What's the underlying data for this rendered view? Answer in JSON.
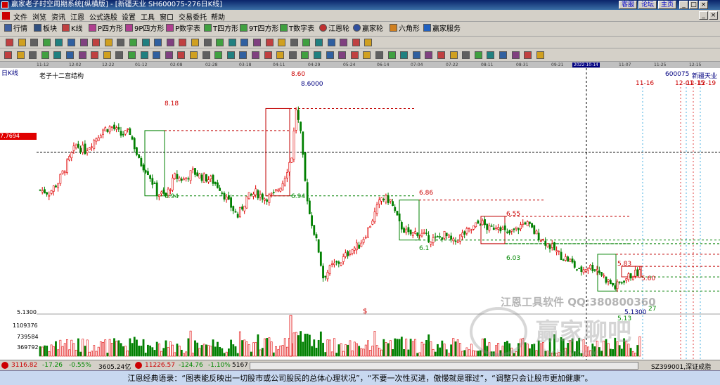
{
  "window": {
    "title": "赢家老子时空周期系统[纵横版] - [新疆天业  SH600075-276日K线]",
    "title_buttons": [
      "客服",
      "论坛",
      "主页"
    ],
    "controls": [
      "_",
      "□",
      "×",
      "_",
      "×"
    ]
  },
  "menu": [
    "文件",
    "浏览",
    "资讯",
    "江恩",
    "公式选股",
    "设置",
    "工具",
    "窗口",
    "交易委托",
    "帮助"
  ],
  "toolbar1": [
    "行情",
    "板块",
    "K线",
    "P四方形",
    "9P四方形",
    "P数字表",
    "T四方形",
    "9T四方形",
    "T数字表",
    "江恩轮",
    "赢家轮",
    "六角形",
    "赢家服务"
  ],
  "time_axis": {
    "labels": [
      "11-12",
      "12-02",
      "12-22",
      "01-12",
      "02-08",
      "02-28",
      "03-18",
      "04-11",
      "04-29",
      "05-24",
      "06-14",
      "07-04",
      "07-22",
      "08-11",
      "08-31",
      "09-21",
      "2022-10-14",
      "11-07",
      "11-25",
      "12-15"
    ],
    "current": "2022-10-14"
  },
  "chart": {
    "period_label": "日K线",
    "title": "老子十二宫结构",
    "stock_code": "600075",
    "stock_name": "新疆天业",
    "price_tag": "7.7694",
    "min_price_tag": "5.1300",
    "date_marks": [
      "11-16",
      "12-01",
      "12-15",
      "12-19"
    ],
    "box_labels": [
      "8.18",
      "6.94",
      "8.60",
      "6.94",
      "6.86",
      "6.1",
      "6.55",
      "6.03",
      "5.83",
      "5.60",
      "5.13",
      "27"
    ],
    "peak_label": "8.6000",
    "low_label": "5.1300",
    "dollar_mark": "$",
    "volume_ticks": [
      "1109376",
      "739584",
      "369792"
    ],
    "watermark_text": "江恩工具软件  QQ:380800360",
    "watermark_logo": "赢家聊吧",
    "watermark_url": "liaoba.yjcycle"
  },
  "chart_data": {
    "type": "candlestick",
    "ylim": [
      4.8,
      9.1
    ],
    "price_levels": {
      "current_line": 7.7694,
      "low": 5.13,
      "high": 8.6
    },
    "close_path": [
      [
        0,
        7.05
      ],
      [
        4,
        7.0
      ],
      [
        8,
        7.2
      ],
      [
        12,
        7.55
      ],
      [
        16,
        7.9
      ],
      [
        20,
        7.8
      ],
      [
        24,
        8.0
      ],
      [
        28,
        8.2
      ],
      [
        32,
        8.25
      ],
      [
        36,
        8.1
      ],
      [
        40,
        8.15
      ],
      [
        44,
        7.6
      ],
      [
        48,
        7.4
      ],
      [
        52,
        7.0
      ],
      [
        56,
        6.94
      ],
      [
        60,
        7.3
      ],
      [
        64,
        7.25
      ],
      [
        68,
        7.4
      ],
      [
        72,
        7.3
      ],
      [
        76,
        7.25
      ],
      [
        80,
        7.1
      ],
      [
        84,
        6.8
      ],
      [
        88,
        6.55
      ],
      [
        92,
        6.9
      ],
      [
        96,
        7.0
      ],
      [
        100,
        6.9
      ],
      [
        104,
        6.95
      ],
      [
        108,
        7.2
      ],
      [
        112,
        7.7
      ],
      [
        114,
        8.6
      ],
      [
        116,
        8.1
      ],
      [
        118,
        7.2
      ],
      [
        120,
        6.6
      ],
      [
        124,
        5.9
      ],
      [
        126,
        5.4
      ],
      [
        130,
        5.6
      ],
      [
        134,
        5.7
      ],
      [
        138,
        5.9
      ],
      [
        142,
        6.0
      ],
      [
        146,
        6.3
      ],
      [
        150,
        6.7
      ],
      [
        152,
        6.9
      ],
      [
        156,
        6.85
      ],
      [
        160,
        6.4
      ],
      [
        164,
        6.2
      ],
      [
        168,
        6.25
      ],
      [
        172,
        6.15
      ],
      [
        176,
        6.1
      ],
      [
        180,
        6.2
      ],
      [
        184,
        6.05
      ],
      [
        188,
        6.2
      ],
      [
        192,
        6.3
      ],
      [
        196,
        6.45
      ],
      [
        200,
        6.3
      ],
      [
        204,
        6.4
      ],
      [
        208,
        6.2
      ],
      [
        212,
        6.3
      ],
      [
        216,
        6.45
      ],
      [
        220,
        6.25
      ],
      [
        224,
        6.1
      ],
      [
        228,
        5.95
      ],
      [
        232,
        5.8
      ],
      [
        236,
        5.7
      ],
      [
        240,
        5.5
      ],
      [
        244,
        5.6
      ],
      [
        248,
        5.55
      ],
      [
        252,
        5.35
      ],
      [
        256,
        5.2
      ],
      [
        260,
        5.35
      ],
      [
        264,
        5.45
      ],
      [
        268,
        5.5
      ]
    ]
  },
  "status": {
    "sh_index": "3116.82",
    "sh_change": "-17.26",
    "sh_pct": "-0.55%",
    "sh_amount": "3605.24亿",
    "sz_index": "11226.57",
    "sz_change": "-124.76",
    "sz_pct": "-1.10%",
    "sz_amount": "5167",
    "right_label": "SZ399001,深证成指"
  },
  "quote": "江恩经典语录：“图表能反映出一切股市或公司股民的总体心理状况”，“不要一次性买进，傲慢就是罪过”，“调整只会让股市更加健康”。",
  "colors": {
    "up": "#e00000",
    "down": "#008000",
    "box_red": "#c00000",
    "box_green": "#008000",
    "quote_bar": "#c8d8f0"
  }
}
